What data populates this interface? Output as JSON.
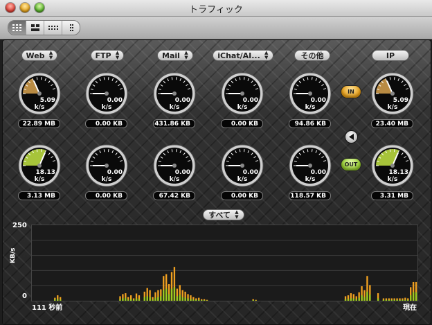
{
  "window": {
    "title": "トラフィック"
  },
  "toolbar": {
    "view_buttons": [
      {
        "name": "grid-view",
        "active": true
      },
      {
        "name": "quad-view",
        "active": false
      },
      {
        "name": "row-view",
        "active": false
      },
      {
        "name": "column-view",
        "active": false
      }
    ]
  },
  "categories": [
    {
      "label": "Web"
    },
    {
      "label": "FTP"
    },
    {
      "label": "Mail"
    },
    {
      "label": "iChat/AI..."
    },
    {
      "label": "その他"
    },
    {
      "label": "IP"
    }
  ],
  "in_gauges": [
    {
      "value": "5.09",
      "unit": "k/s",
      "total": "22.89 MB",
      "fill": 0.35
    },
    {
      "value": "0.00",
      "unit": "k/s",
      "total": "0.00 KB",
      "fill": 0
    },
    {
      "value": "0.00",
      "unit": "k/s",
      "total": "431.86 KB",
      "fill": 0
    },
    {
      "value": "0.00",
      "unit": "k/s",
      "total": "0.00 KB",
      "fill": 0
    },
    {
      "value": "0.00",
      "unit": "k/s",
      "total": "94.86 KB",
      "fill": 0
    },
    {
      "value": "5.09",
      "unit": "k/s",
      "total": "23.40 MB",
      "fill": 0.35
    }
  ],
  "out_gauges": [
    {
      "value": "18.13",
      "unit": "k/s",
      "total": "3.13 MB",
      "fill": 0.6
    },
    {
      "value": "0.00",
      "unit": "k/s",
      "total": "0.00 KB",
      "fill": 0
    },
    {
      "value": "0.00",
      "unit": "k/s",
      "total": "67.42 KB",
      "fill": 0
    },
    {
      "value": "0.00",
      "unit": "k/s",
      "total": "0.00 KB",
      "fill": 0
    },
    {
      "value": "0.00",
      "unit": "k/s",
      "total": "118.57 KB",
      "fill": 0
    },
    {
      "value": "18.13",
      "unit": "k/s",
      "total": "3.31 MB",
      "fill": 0.6
    }
  ],
  "indicators": {
    "in_label": "IN",
    "out_label": "OUT"
  },
  "colors": {
    "in": "#f0a020",
    "out": "#9ccc20",
    "gauge_in_face": "#b98b43",
    "gauge_out_face": "#a7c43a"
  },
  "history": {
    "filter_label": "すべて",
    "y_max_label": "250",
    "y_min_label": "0",
    "y_unit": "KB/s",
    "x_start_label": "111 秒前",
    "x_end_label": "現在"
  },
  "chart_data": {
    "type": "bar",
    "ylabel": "KB/s",
    "ylim": [
      0,
      250
    ],
    "x_labels": [
      "111 秒前",
      "現在"
    ],
    "series": [
      {
        "values": [
          0,
          0,
          0,
          0,
          0,
          0,
          0,
          0,
          10,
          18,
          12,
          0,
          0,
          0,
          0,
          0,
          0,
          0,
          0,
          0,
          0,
          0,
          0,
          0,
          0,
          0,
          0,
          0,
          0,
          0,
          0,
          0,
          15,
          22,
          25,
          12,
          18,
          8,
          24,
          18,
          0,
          30,
          42,
          35,
          12,
          28,
          35,
          38,
          82,
          88,
          55,
          95,
          112,
          40,
          52,
          35,
          30,
          22,
          18,
          12,
          8,
          10,
          5,
          5,
          3,
          0,
          0,
          0,
          0,
          0,
          0,
          0,
          0,
          0,
          0,
          0,
          0,
          0,
          0,
          0,
          0,
          5,
          3,
          0,
          0,
          0,
          0,
          0,
          0,
          0,
          0,
          0,
          0,
          0,
          0,
          0,
          0,
          0,
          0,
          0,
          0,
          0,
          0,
          0,
          0,
          0,
          0,
          0,
          0,
          0,
          0,
          0,
          0,
          0,
          0,
          15,
          18,
          25,
          22,
          15,
          28,
          48,
          35,
          82,
          52,
          0,
          0,
          25,
          0,
          8,
          8,
          8,
          8,
          8,
          8,
          8,
          8,
          10,
          8,
          45,
          62,
          62
        ]
      },
      {
        "values": [
          0,
          0,
          0,
          0,
          0,
          0,
          0,
          0,
          5,
          6,
          4,
          0,
          0,
          0,
          0,
          0,
          0,
          0,
          0,
          0,
          0,
          0,
          0,
          0,
          0,
          0,
          0,
          0,
          0,
          0,
          0,
          0,
          5,
          8,
          10,
          4,
          6,
          3,
          8,
          6,
          0,
          12,
          15,
          12,
          4,
          10,
          12,
          15,
          35,
          40,
          22,
          40,
          45,
          15,
          20,
          12,
          10,
          8,
          6,
          4,
          3,
          3,
          2,
          2,
          1,
          0,
          0,
          0,
          0,
          0,
          0,
          0,
          0,
          0,
          0,
          0,
          0,
          0,
          0,
          0,
          0,
          2,
          1,
          0,
          0,
          0,
          0,
          0,
          0,
          0,
          0,
          0,
          0,
          0,
          0,
          0,
          0,
          0,
          0,
          0,
          0,
          0,
          0,
          0,
          0,
          0,
          0,
          0,
          0,
          0,
          0,
          0,
          0,
          0,
          0,
          5,
          6,
          8,
          8,
          5,
          10,
          18,
          12,
          30,
          20,
          0,
          0,
          8,
          0,
          3,
          3,
          3,
          3,
          3,
          3,
          3,
          3,
          3,
          3,
          18,
          28,
          28
        ]
      }
    ]
  }
}
